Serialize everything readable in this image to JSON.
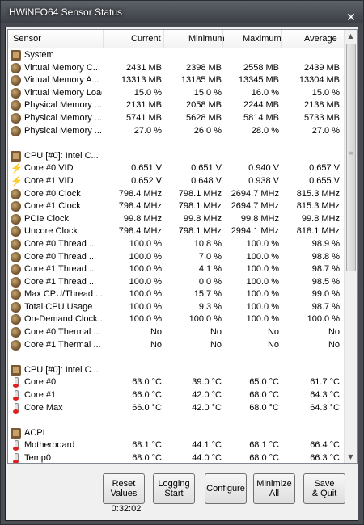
{
  "window": {
    "title": "HWiNFO64 Sensor Status",
    "close_glyph": "✕"
  },
  "columns": {
    "sensor": "Sensor",
    "current": "Current",
    "minimum": "Minimum",
    "maximum": "Maximum",
    "average": "Average"
  },
  "rows": [
    {
      "type": "group",
      "icon": "chip-icon",
      "name": "System"
    },
    {
      "type": "item",
      "icon": "sensor-icon",
      "name": "Virtual Memory C...",
      "current": "2431 MB",
      "minimum": "2398 MB",
      "maximum": "2558 MB",
      "average": "2439 MB"
    },
    {
      "type": "item",
      "icon": "sensor-icon",
      "name": "Virtual Memory A...",
      "current": "13313 MB",
      "minimum": "13185 MB",
      "maximum": "13345 MB",
      "average": "13304 MB"
    },
    {
      "type": "item",
      "icon": "sensor-icon",
      "name": "Virtual Memory Load",
      "current": "15.0 %",
      "minimum": "15.0 %",
      "maximum": "16.0 %",
      "average": "15.0 %"
    },
    {
      "type": "item",
      "icon": "sensor-icon",
      "name": "Physical Memory ...",
      "current": "2131 MB",
      "minimum": "2058 MB",
      "maximum": "2244 MB",
      "average": "2138 MB"
    },
    {
      "type": "item",
      "icon": "sensor-icon",
      "name": "Physical Memory ...",
      "current": "5741 MB",
      "minimum": "5628 MB",
      "maximum": "5814 MB",
      "average": "5733 MB"
    },
    {
      "type": "item",
      "icon": "sensor-icon",
      "name": "Physical Memory ...",
      "current": "27.0 %",
      "minimum": "26.0 %",
      "maximum": "28.0 %",
      "average": "27.0 %"
    },
    {
      "type": "blank"
    },
    {
      "type": "group",
      "icon": "chip-icon",
      "name": "CPU [#0]: Intel C..."
    },
    {
      "type": "item",
      "icon": "voltage-icon",
      "name": "Core #0 VID",
      "current": "0.651 V",
      "minimum": "0.651 V",
      "maximum": "0.940 V",
      "average": "0.657 V"
    },
    {
      "type": "item",
      "icon": "voltage-icon",
      "name": "Core #1 VID",
      "current": "0.652 V",
      "minimum": "0.648 V",
      "maximum": "0.938 V",
      "average": "0.655 V"
    },
    {
      "type": "item",
      "icon": "sensor-icon",
      "name": "Core #0 Clock",
      "current": "798.4 MHz",
      "minimum": "798.1 MHz",
      "maximum": "2694.7 MHz",
      "average": "815.3 MHz"
    },
    {
      "type": "item",
      "icon": "sensor-icon",
      "name": "Core #1 Clock",
      "current": "798.4 MHz",
      "minimum": "798.1 MHz",
      "maximum": "2694.7 MHz",
      "average": "815.3 MHz"
    },
    {
      "type": "item",
      "icon": "sensor-icon",
      "name": "PCIe Clock",
      "current": "99.8 MHz",
      "minimum": "99.8 MHz",
      "maximum": "99.8 MHz",
      "average": "99.8 MHz"
    },
    {
      "type": "item",
      "icon": "sensor-icon",
      "name": "Uncore Clock",
      "current": "798.4 MHz",
      "minimum": "798.1 MHz",
      "maximum": "2994.1 MHz",
      "average": "818.1 MHz"
    },
    {
      "type": "item",
      "icon": "sensor-icon",
      "name": "Core #0 Thread ...",
      "current": "100.0 %",
      "minimum": "10.8 %",
      "maximum": "100.0 %",
      "average": "98.9 %"
    },
    {
      "type": "item",
      "icon": "sensor-icon",
      "name": "Core #0 Thread ...",
      "current": "100.0 %",
      "minimum": "7.0 %",
      "maximum": "100.0 %",
      "average": "98.8 %"
    },
    {
      "type": "item",
      "icon": "sensor-icon",
      "name": "Core #1 Thread ...",
      "current": "100.0 %",
      "minimum": "4.1 %",
      "maximum": "100.0 %",
      "average": "98.7 %"
    },
    {
      "type": "item",
      "icon": "sensor-icon",
      "name": "Core #1 Thread ...",
      "current": "100.0 %",
      "minimum": "0.0 %",
      "maximum": "100.0 %",
      "average": "98.5 %"
    },
    {
      "type": "item",
      "icon": "sensor-icon",
      "name": "Max CPU/Thread ...",
      "current": "100.0 %",
      "minimum": "15.7 %",
      "maximum": "100.0 %",
      "average": "99.0 %"
    },
    {
      "type": "item",
      "icon": "sensor-icon",
      "name": "Total CPU Usage",
      "current": "100.0 %",
      "minimum": "9.3 %",
      "maximum": "100.0 %",
      "average": "98.7 %"
    },
    {
      "type": "item",
      "icon": "sensor-icon",
      "name": "On-Demand Clock...",
      "current": "100.0 %",
      "minimum": "100.0 %",
      "maximum": "100.0 %",
      "average": "100.0 %"
    },
    {
      "type": "item",
      "icon": "sensor-icon",
      "name": "Core #0 Thermal ...",
      "current": "No",
      "minimum": "No",
      "maximum": "No",
      "average": "No"
    },
    {
      "type": "item",
      "icon": "sensor-icon",
      "name": "Core #1 Thermal ...",
      "current": "No",
      "minimum": "No",
      "maximum": "No",
      "average": "No"
    },
    {
      "type": "blank"
    },
    {
      "type": "group",
      "icon": "chip-icon",
      "name": "CPU [#0]: Intel C..."
    },
    {
      "type": "item",
      "icon": "thermometer-icon",
      "name": "Core #0",
      "current": "63.0 °C",
      "minimum": "39.0 °C",
      "maximum": "65.0 °C",
      "average": "61.7 °C"
    },
    {
      "type": "item",
      "icon": "thermometer-icon",
      "name": "Core #1",
      "current": "66.0 °C",
      "minimum": "42.0 °C",
      "maximum": "68.0 °C",
      "average": "64.3 °C"
    },
    {
      "type": "item",
      "icon": "thermometer-icon",
      "name": "Core Max",
      "current": "66.0 °C",
      "minimum": "42.0 °C",
      "maximum": "68.0 °C",
      "average": "64.3 °C"
    },
    {
      "type": "blank"
    },
    {
      "type": "group",
      "icon": "chip-icon",
      "name": "ACPI"
    },
    {
      "type": "item",
      "icon": "thermometer-icon",
      "name": "Motherboard",
      "current": "68.1 °C",
      "minimum": "44.1 °C",
      "maximum": "68.1 °C",
      "average": "66.4 °C"
    },
    {
      "type": "item",
      "icon": "thermometer-icon",
      "name": "Temp0",
      "current": "68.0 °C",
      "minimum": "44.0 °C",
      "maximum": "68.0 °C",
      "average": "66.3 °C"
    }
  ],
  "buttons": {
    "reset": [
      "Reset",
      "Values"
    ],
    "logging": [
      "Logging",
      "Start"
    ],
    "configure": "Configure",
    "minimize": [
      "Minimize",
      "All"
    ],
    "save": [
      "Save",
      "& Quit"
    ]
  },
  "timer": "0:32:02",
  "scrollbar": {
    "up_glyph": "▲",
    "down_glyph": "▼",
    "grip_glyph": "≡"
  }
}
